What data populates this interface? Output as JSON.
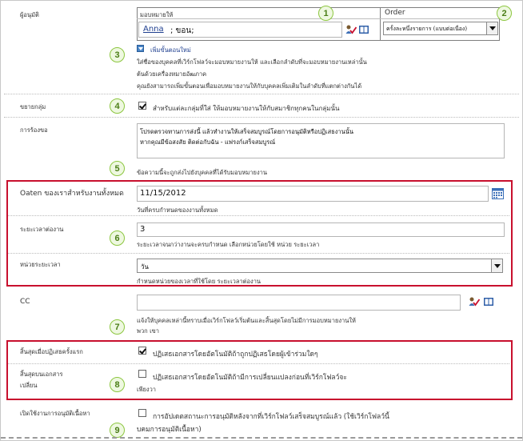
{
  "assignment": {
    "label": "ผู้อนุมัติ",
    "assign_to_header": "มอบหมายให้",
    "order_header": "Order",
    "assignee_value": "Anna",
    "assignee_rest": " ; ขอน;",
    "order_value": "ครั้งละหนึ่งรายการ (แบบต่อเนื่อง)",
    "add_stage_label": "เพิ่มขั้นตอนใหม่",
    "desc_lines": [
      "ใส่ชื่อของบุคคลที่เวิร์กโฟลว์จะมอบหมายงานให้ และเลือกลำดับที่จะมอบหมายงานเหล่านั้น",
      "ต้นด้วยเครื่องหมายอัฒภาค",
      "คุณยังสามารถเพิ่มขั้นตอนเพื่อมอบหมายงานให้กับบุคคลเพิ่มเติมในลำดับที่แตกต่างกันได้"
    ]
  },
  "expand_groups": {
    "label": "ขยายกลุ่ม",
    "checkbox_label": "สำหรับแต่ละกลุ่มที่ใส่ ให้มอบหมายงานให้กับสมาชิกทุกคนในกลุ่มนั้น",
    "checked": true
  },
  "request": {
    "label": "การร้องขอ",
    "text_line1": "โปรดตรวจทานการส่งนี้ แล้วทำงานให้เสร็จสมบูรณ์โดยการอนุมัติหรือปฏิเสธงานนั้น",
    "text_line2": "หากคุณมีข้อสงสัย ติดต่อกับฉัน - แฟรงก์เสร็จสมบูรณ์",
    "desc": "ข้อความนี้จะถูกส่งไปยังบุคคลที่ได้รับมอบหมายงาน"
  },
  "due_date": {
    "label": "Oaten ของเราสำหรับงานทั้งหมด",
    "value": "11/15/2012",
    "desc": "วันที่ครบกำหนดของงานทั้งหมด"
  },
  "duration": {
    "label": "ระยะเวลาต่องาน",
    "value": "3",
    "desc": "ระยะเวลาจนกว่างานจะครบกำหนด เลือกหน่วยโดยใช้ หน่วย ระยะเวลา"
  },
  "duration_units": {
    "label": "หน่วยระยะเวลา",
    "value": "วัน",
    "desc": "กำหนดหน่วยของเวลาที่ใช้โดย ระยะเวลาต่องาน"
  },
  "cc": {
    "label": "CC",
    "value": "",
    "desc_line1": "แจ้งให้บุคคลเหล่านี้ทราบเมื่อเวิร์กโฟลว์เริ่มต้นและสิ้นสุดโดยไม่มีการมอบหมายงานให้",
    "desc_line2": "พวก เขา"
  },
  "end_first_reject": {
    "label": "สิ้นสุดเมื่อปฏิเสธครั้งแรก",
    "checkbox_label": "ปฏิเสธเอกสารโดยอัตโนมัติถ้าถูกปฏิเสธโดยผู้เข้าร่วมใดๆ",
    "checked": true
  },
  "end_doc_change": {
    "label_line1": "สิ้นสุดบนเอกสาร",
    "label_line2": "เปลี่ยน",
    "checkbox_label": "ปฏิเสธเอกสารโดยอัตโนมัติถ้ามีการเปลี่ยนแปลงก่อนที่เวิร์กโฟลว์จะ",
    "checkbox_label2": "เพียงวา",
    "checked": false
  },
  "content_approval": {
    "label": "เปิดใช้งานการอนุมัติเนื้อหา",
    "checkbox_label": "การอัปเดตสถานะการอนุมัติหลังจากที่เวิร์กโฟลว์เสร็จสมบูรณ์แล้ว (ใช้เวิร์กโฟลว์นี้",
    "checkbox_label2": "บคมการอนุมัติเนื้อหา)",
    "checked": false
  },
  "callouts": [
    "1",
    "2",
    "3",
    "4",
    "5",
    "6",
    "7",
    "8",
    "9"
  ],
  "colors": {
    "callout_green": "#8cc63f",
    "highlight_red": "#c8102e",
    "link_blue": "#1f3f8f"
  }
}
